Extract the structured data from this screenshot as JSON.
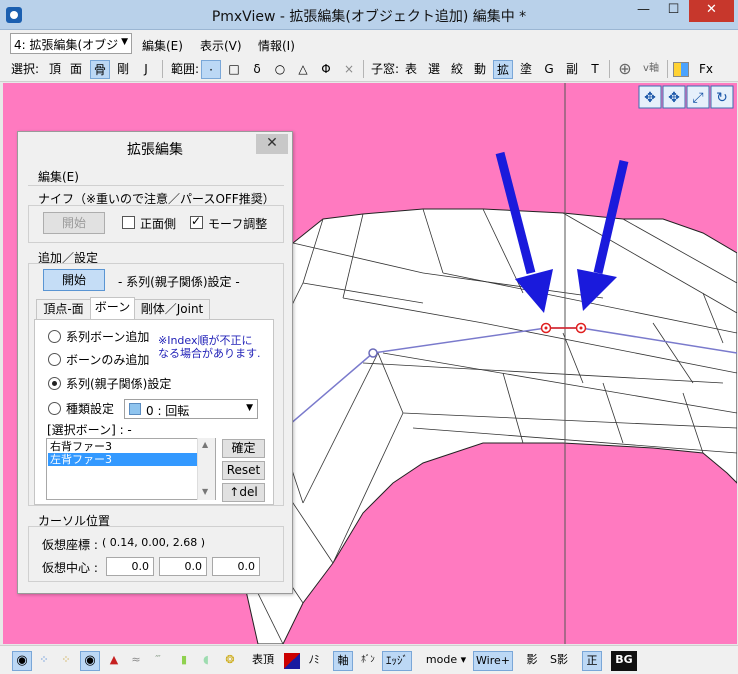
{
  "window": {
    "title": "PmxView - 拡張編集(オブジェクト追加) 編集中 *",
    "minimize_label": "—",
    "maximize_label": "☐",
    "close_label": "✕"
  },
  "menubar": {
    "mode_select": "4: 拡張編集(オブジ",
    "items": [
      "編集(E)",
      "表示(V)",
      "情報(I)"
    ]
  },
  "toolbar": {
    "select_label": "選択:",
    "select_items": [
      "頂",
      "面",
      "骨",
      "剛",
      "J"
    ],
    "range_label": "範囲:",
    "range_items": [
      "·",
      "□",
      "δ",
      "○",
      "△",
      "Φ",
      "×"
    ],
    "child_window_label": "子窓:",
    "child_items": [
      "表",
      "選",
      "絞",
      "動",
      "拡",
      "塗",
      "G",
      "副",
      "T"
    ],
    "axis_label": "v軸",
    "fx_label": "Fx"
  },
  "dialog": {
    "title": "拡張編集",
    "close_label": "✕",
    "menu_edit": "編集(E)",
    "knife_group": "ナイフ（※重いので注意／パースOFF推奨）",
    "knife_start": "開始",
    "front_side_label": "正面側",
    "front_side_checked": false,
    "morph_adjust_label": "モーフ調整",
    "morph_adjust_checked": true,
    "add_group": "追加／設定",
    "add_start": "開始",
    "add_mode_label": "- 系列(親子関係)設定 -",
    "tabs": [
      "頂点-面",
      "ボーン",
      "剛体／Joint"
    ],
    "active_tab": "ボーン",
    "radios": [
      "系列ボーン追加",
      "ボーンのみ追加",
      "系列(親子関係)設定",
      "種類設定"
    ],
    "selected_radio": "系列(親子関係)設定",
    "note": "※Index順が不正に\nなる場合があります.",
    "type_select": "0 : 回転",
    "selected_bone_label": "[選択ボーン] : -",
    "bone_list": [
      "右背ファー3",
      "左背ファー3"
    ],
    "bone_list_selected": "左背ファー3",
    "btn_confirm": "確定",
    "btn_reset": "Reset",
    "btn_del": "↑del",
    "cursor_group": "カーソル位置",
    "virtual_coord_label": "仮想座標 :",
    "virtual_coord_value": "( 0.14, 0.00, 2.68 )",
    "virtual_center_label": "仮想中心 :",
    "virtual_center_values": [
      "0.0",
      "0.0",
      "0.0"
    ]
  },
  "statusbar": {
    "items": [
      "表頂",
      "ﾉﾐ",
      "軸",
      "ﾎﾞﾝ",
      "ｴｯｼﾞ",
      "mode ▾",
      "Wire+",
      "影",
      "S影",
      "正",
      "BG"
    ]
  },
  "colors": {
    "viewport_bg": "#ff7ac0",
    "arrow": "#1a1adc",
    "bone_line": "#7a7acc",
    "highlight": "#3399ff",
    "title_bar": "#b9d1ea"
  }
}
